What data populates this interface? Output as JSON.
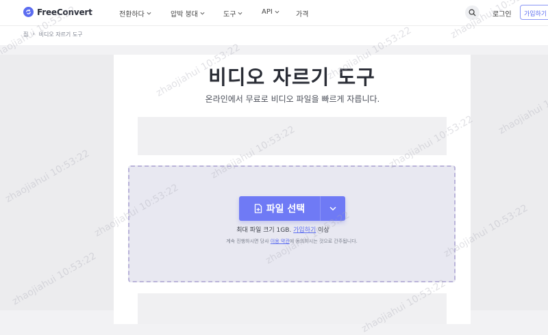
{
  "header": {
    "brand": "FreeConvert",
    "nav": [
      {
        "label": "전환하다",
        "has_dropdown": true
      },
      {
        "label": "압박 붕대",
        "has_dropdown": true
      },
      {
        "label": "도구",
        "has_dropdown": true
      },
      {
        "label": "API",
        "has_dropdown": true
      },
      {
        "label": "가격",
        "has_dropdown": false
      }
    ],
    "login": "로그인",
    "signup": "가입하기"
  },
  "breadcrumb": {
    "home": "집",
    "separator": "›",
    "current": "비디오 자르기 도구"
  },
  "main": {
    "title": "비디오 자르기 도구",
    "subtitle": "온라인에서 무료로 비디오 파일을 빠르게 자릅니다."
  },
  "upload": {
    "choose_label": "파일 선택",
    "max_prefix": "최대 파일 크기 1GB.",
    "max_link": "가입하기",
    "max_suffix": "이상",
    "terms_prefix": "계속 진행하시면 당사",
    "terms_link": "이용 약관",
    "terms_suffix": "에 동의하시는 것으로 간주됩니다."
  },
  "watermark": "zhaojiahui 10:53:22",
  "colors": {
    "accent": "#6f7af5",
    "brand": "#5b6cf0",
    "dropzone_bg": "#e8e8f1",
    "dropzone_border": "#b9b3d9"
  },
  "icons": {
    "logo": "refresh-circle-icon",
    "search": "search-icon",
    "dropdown": "chevron-down-icon",
    "file": "file-plus-icon"
  }
}
